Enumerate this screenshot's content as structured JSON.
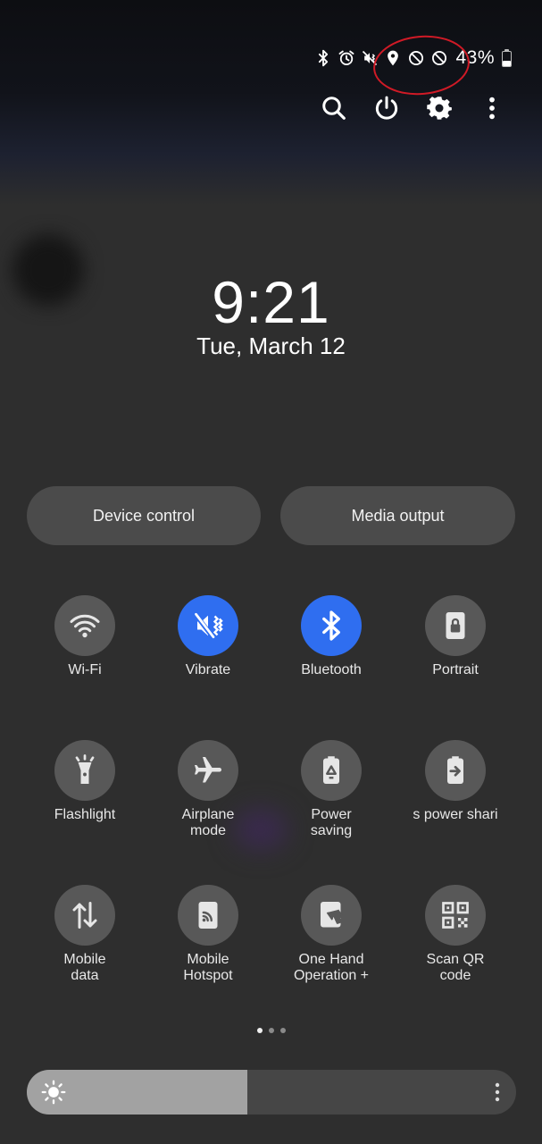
{
  "status_bar": {
    "icons": [
      "bluetooth-icon",
      "alarm-icon",
      "vibrate-icon",
      "location-icon",
      "blocked-icon",
      "blocked-icon"
    ],
    "battery_percent": "43%",
    "battery_level": 0.43
  },
  "top_actions": [
    "search-icon",
    "power-icon",
    "gear-icon",
    "more-vert-icon"
  ],
  "clock": {
    "time": "9:21",
    "date": "Tue, March 12"
  },
  "pills": {
    "device_control": "Device control",
    "media_output": "Media output"
  },
  "tiles": [
    {
      "label": "Wi-Fi",
      "icon": "wifi-icon",
      "active": false
    },
    {
      "label": "Vibrate",
      "icon": "vibrate-icon",
      "active": true
    },
    {
      "label": "Bluetooth",
      "icon": "bluetooth-icon",
      "active": true
    },
    {
      "label": "Portrait",
      "icon": "portrait-lock-icon",
      "active": false
    },
    {
      "label": "Flashlight",
      "icon": "flashlight-icon",
      "active": false
    },
    {
      "label": "Airplane\nmode",
      "icon": "airplane-icon",
      "active": false
    },
    {
      "label": "Power\nsaving",
      "icon": "power-saving-icon",
      "active": false
    },
    {
      "label": "s power shari",
      "icon": "wireless-power-share-icon",
      "active": false
    },
    {
      "label": "Mobile\ndata",
      "icon": "mobile-data-icon",
      "active": false
    },
    {
      "label": "Mobile\nHotspot",
      "icon": "hotspot-icon",
      "active": false
    },
    {
      "label": "One Hand\nOperation +",
      "icon": "one-hand-icon",
      "active": false
    },
    {
      "label": "Scan QR\ncode",
      "icon": "qr-code-icon",
      "active": false
    }
  ],
  "pages": {
    "count": 3,
    "current": 1
  },
  "brightness": {
    "level": 0.45
  },
  "colors": {
    "active": "#2f6ef0",
    "tile": "#585858",
    "annotation": "#d01a26"
  }
}
